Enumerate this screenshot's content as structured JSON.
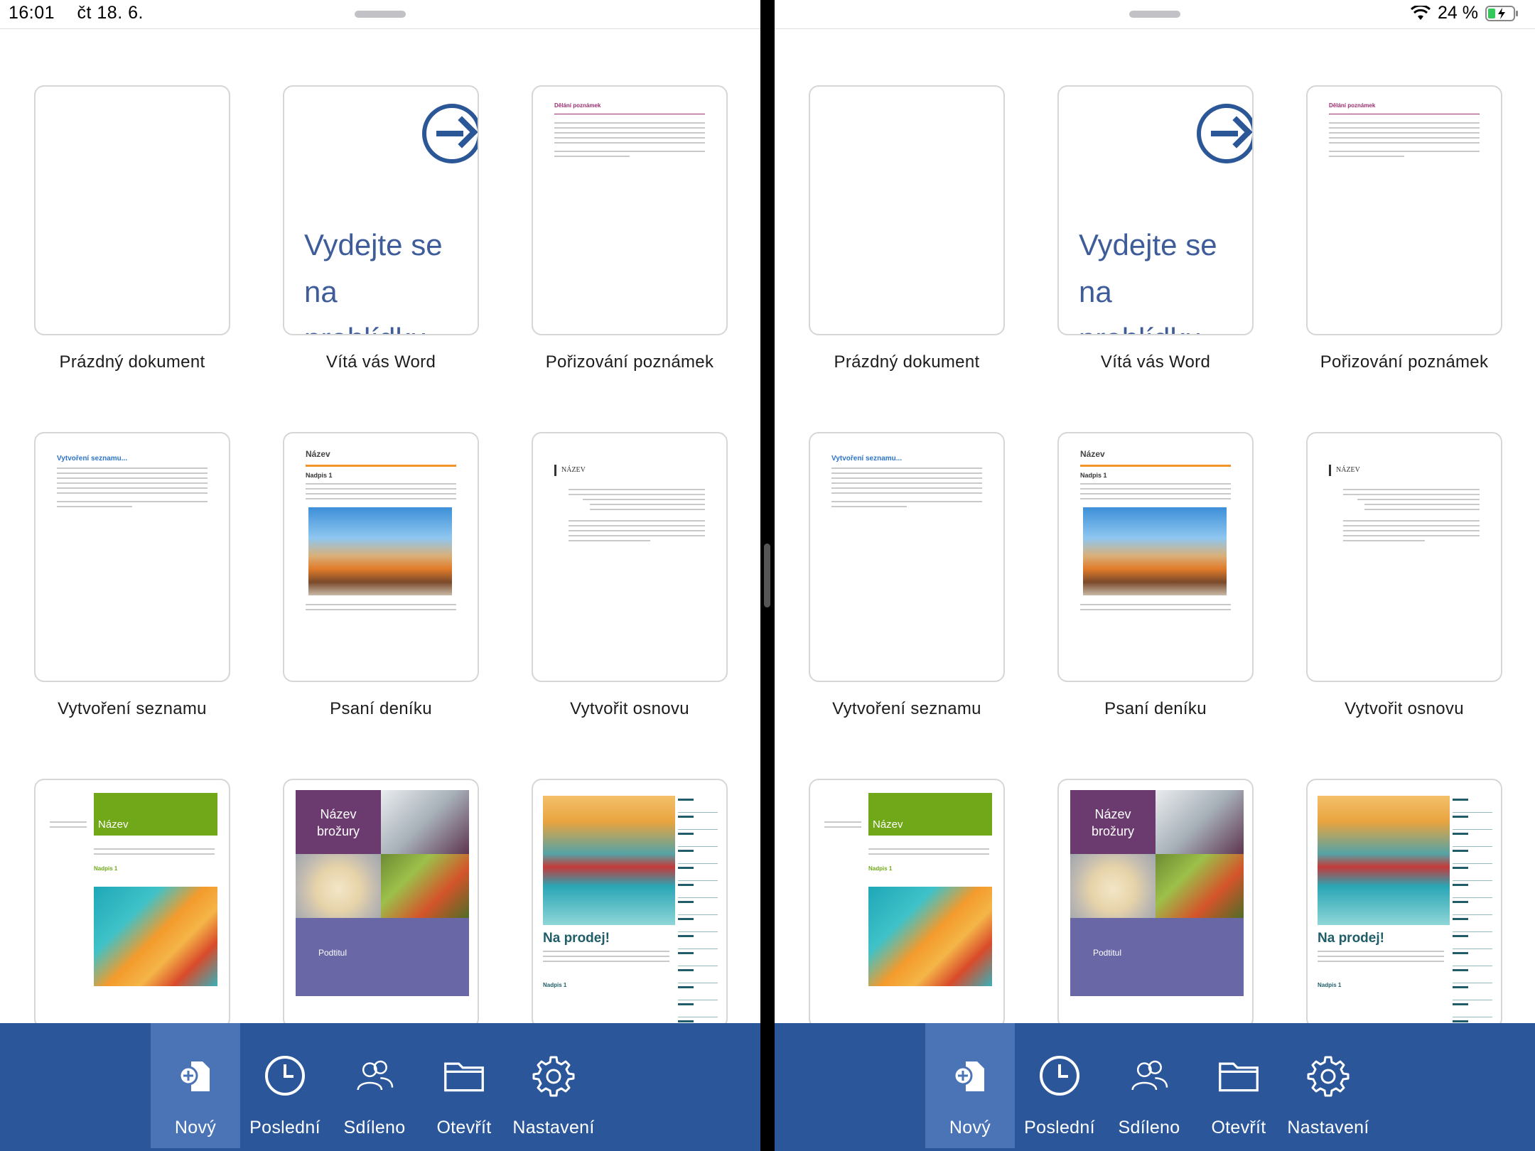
{
  "status": {
    "time": "16:01",
    "date": "čt 18. 6.",
    "battery": "24 %"
  },
  "templates": [
    {
      "id": "blank",
      "label": "Prázdný dokument"
    },
    {
      "id": "welcome",
      "label": "Vítá vás Word",
      "preview_text": "Vydejte se na prohlídku"
    },
    {
      "id": "notes",
      "label": "Pořizování poznámek",
      "preview_title": "Dělání poznámek"
    },
    {
      "id": "list",
      "label": "Vytvoření seznamu",
      "preview_title": "Vytvoření seznamu..."
    },
    {
      "id": "journal",
      "label": "Psaní deníku",
      "preview_title": "Název",
      "preview_heading": "Nadpis 1"
    },
    {
      "id": "outline",
      "label": "Vytvořit osnovu",
      "preview_title": "NÁZEV"
    },
    {
      "id": "newsletter",
      "label": "",
      "preview_title": "Název",
      "preview_heading": "Nadpis 1"
    },
    {
      "id": "brochure",
      "label": "",
      "preview_title": "Název brožury",
      "preview_subtitle": "Podtitul"
    },
    {
      "id": "forsale",
      "label": "",
      "preview_title": "Na prodej!",
      "preview_heading": "Nadpis 1"
    }
  ],
  "tabs": [
    {
      "id": "new",
      "label": "Nový",
      "icon": "new-document-icon",
      "active": true
    },
    {
      "id": "recent",
      "label": "Poslední",
      "icon": "clock-icon",
      "active": false
    },
    {
      "id": "shared",
      "label": "Sdíleno",
      "icon": "people-icon",
      "active": false
    },
    {
      "id": "open",
      "label": "Otevřít",
      "icon": "folder-icon",
      "active": false
    },
    {
      "id": "settings",
      "label": "Nastavení",
      "icon": "gear-icon",
      "active": false
    }
  ],
  "colors": {
    "toolbar": "#2b579a",
    "toolbar_active": "#4a74b5",
    "accent": "#3e5c9a"
  }
}
